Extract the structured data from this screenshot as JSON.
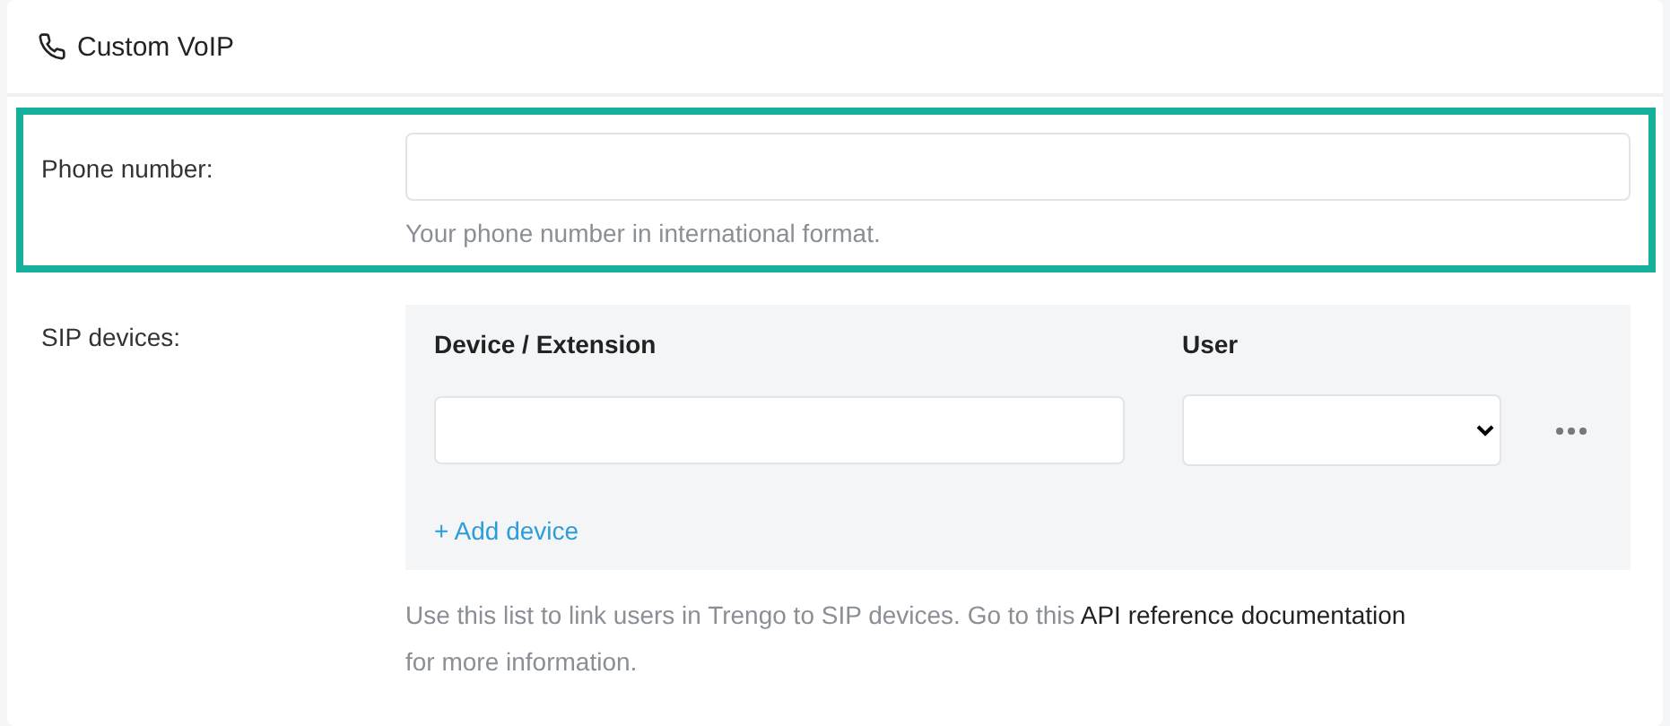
{
  "header": {
    "title": "Custom VoIP"
  },
  "phone_number": {
    "label": "Phone number:",
    "help": "Your phone number in international format.",
    "highlighted": true
  },
  "sip_devices": {
    "label": "SIP devices:",
    "columns": [
      "Device / Extension",
      "User"
    ],
    "rows": [
      {
        "kind": "device-row"
      }
    ],
    "add_action": "+ Add device"
  },
  "help": {
    "text_before": "Use this list to link users in Trengo to SIP devices. Go to this",
    "link": "API reference documentation",
    "text_after": "for more information."
  }
}
